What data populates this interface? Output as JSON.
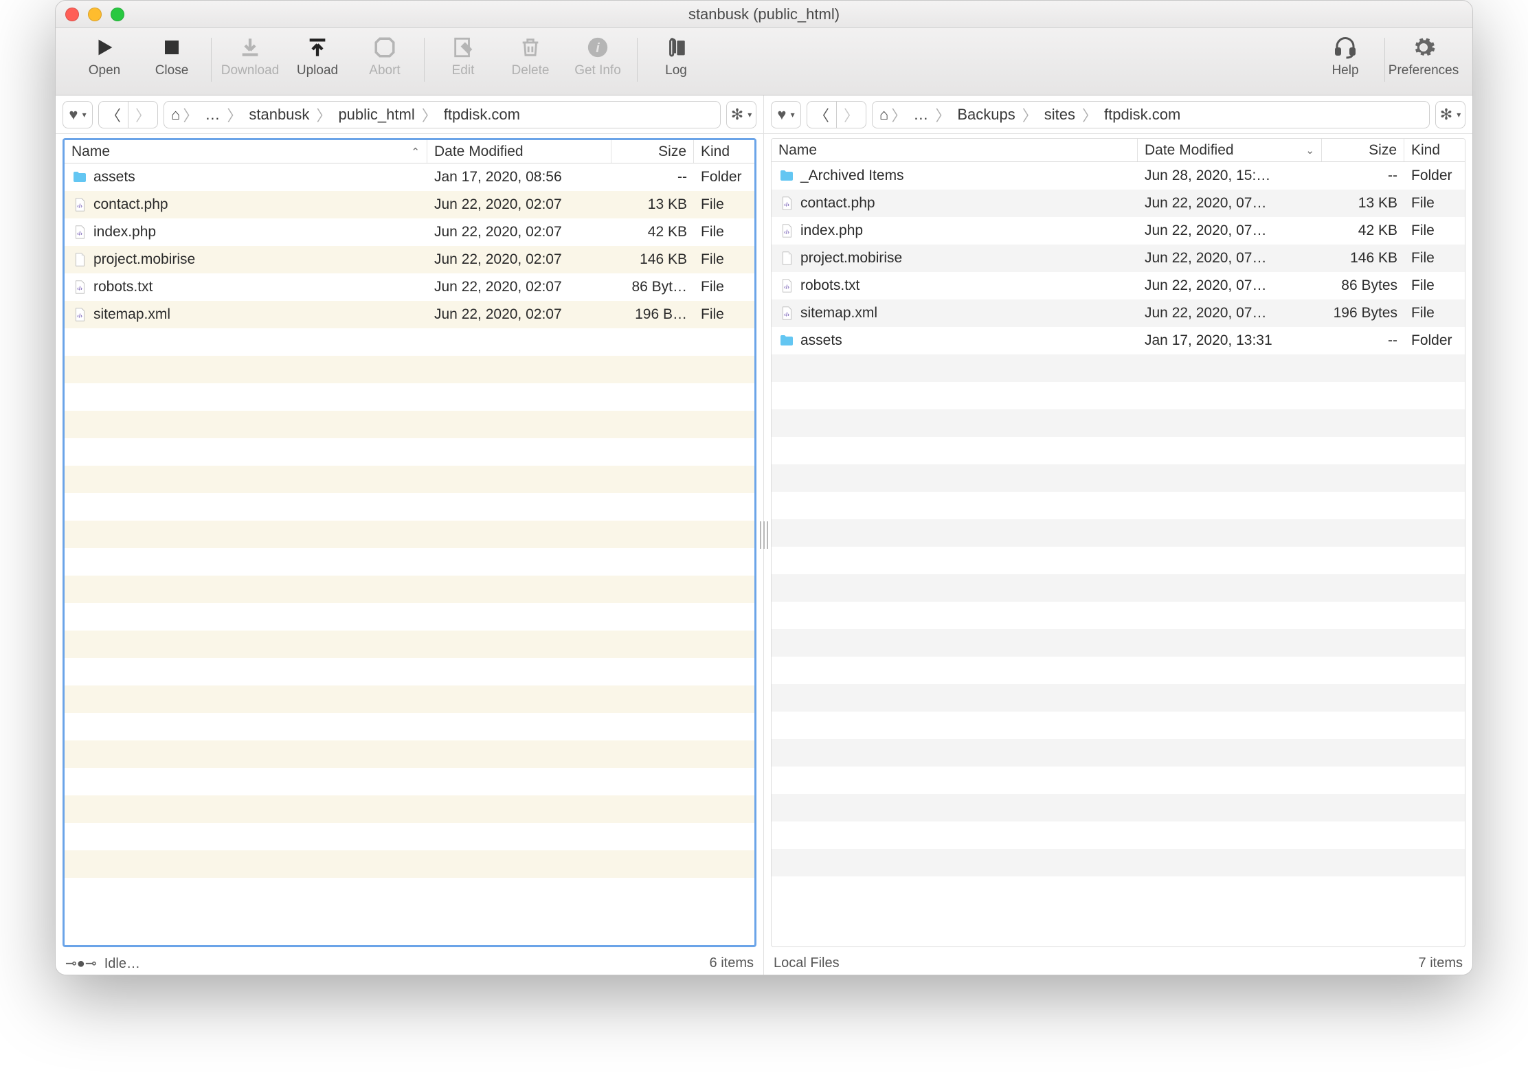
{
  "window_title": "stanbusk (public_html)",
  "toolbar": {
    "open": "Open",
    "close": "Close",
    "download": "Download",
    "upload": "Upload",
    "abort": "Abort",
    "edit": "Edit",
    "delete": "Delete",
    "getinfo": "Get Info",
    "log": "Log",
    "help": "Help",
    "preferences": "Preferences"
  },
  "left": {
    "breadcrumbs": [
      "…",
      "stanbusk",
      "public_html",
      "ftpdisk.com"
    ],
    "columns": {
      "name": "Name",
      "date": "Date Modified",
      "size": "Size",
      "kind": "Kind"
    },
    "sort_asc": true,
    "files": [
      {
        "icon": "folder",
        "name": "assets",
        "date": "Jan 17, 2020, 08:56",
        "size": "--",
        "kind": "Folder"
      },
      {
        "icon": "php",
        "name": "contact.php",
        "date": "Jun 22, 2020, 02:07",
        "size": "13 KB",
        "kind": "File"
      },
      {
        "icon": "php",
        "name": "index.php",
        "date": "Jun 22, 2020, 02:07",
        "size": "42 KB",
        "kind": "File"
      },
      {
        "icon": "file",
        "name": "project.mobirise",
        "date": "Jun 22, 2020, 02:07",
        "size": "146 KB",
        "kind": "File"
      },
      {
        "icon": "txt",
        "name": "robots.txt",
        "date": "Jun 22, 2020, 02:07",
        "size": "86 Byt…",
        "kind": "File"
      },
      {
        "icon": "xml",
        "name": "sitemap.xml",
        "date": "Jun 22, 2020, 02:07",
        "size": "196 B…",
        "kind": "File"
      }
    ],
    "status_left": "Idle…",
    "status_right": "6 items"
  },
  "right": {
    "breadcrumbs": [
      "…",
      "Backups",
      "sites",
      "ftpdisk.com"
    ],
    "columns": {
      "name": "Name",
      "date": "Date Modified",
      "size": "Size",
      "kind": "Kind"
    },
    "sort_asc": false,
    "files": [
      {
        "icon": "folder",
        "name": "_Archived Items",
        "date": "Jun 28, 2020, 15:…",
        "size": "--",
        "kind": "Folder"
      },
      {
        "icon": "php",
        "name": "contact.php",
        "date": "Jun 22, 2020, 07…",
        "size": "13 KB",
        "kind": "File"
      },
      {
        "icon": "php",
        "name": "index.php",
        "date": "Jun 22, 2020, 07…",
        "size": "42 KB",
        "kind": "File"
      },
      {
        "icon": "file",
        "name": "project.mobirise",
        "date": "Jun 22, 2020, 07…",
        "size": "146 KB",
        "kind": "File"
      },
      {
        "icon": "txt",
        "name": "robots.txt",
        "date": "Jun 22, 2020, 07…",
        "size": "86 Bytes",
        "kind": "File"
      },
      {
        "icon": "xml",
        "name": "sitemap.xml",
        "date": "Jun 22, 2020, 07…",
        "size": "196 Bytes",
        "kind": "File"
      },
      {
        "icon": "folder",
        "name": "assets",
        "date": "Jan 17, 2020, 13:31",
        "size": "--",
        "kind": "Folder"
      }
    ],
    "status_left": "Local Files",
    "status_right": "7 items"
  }
}
